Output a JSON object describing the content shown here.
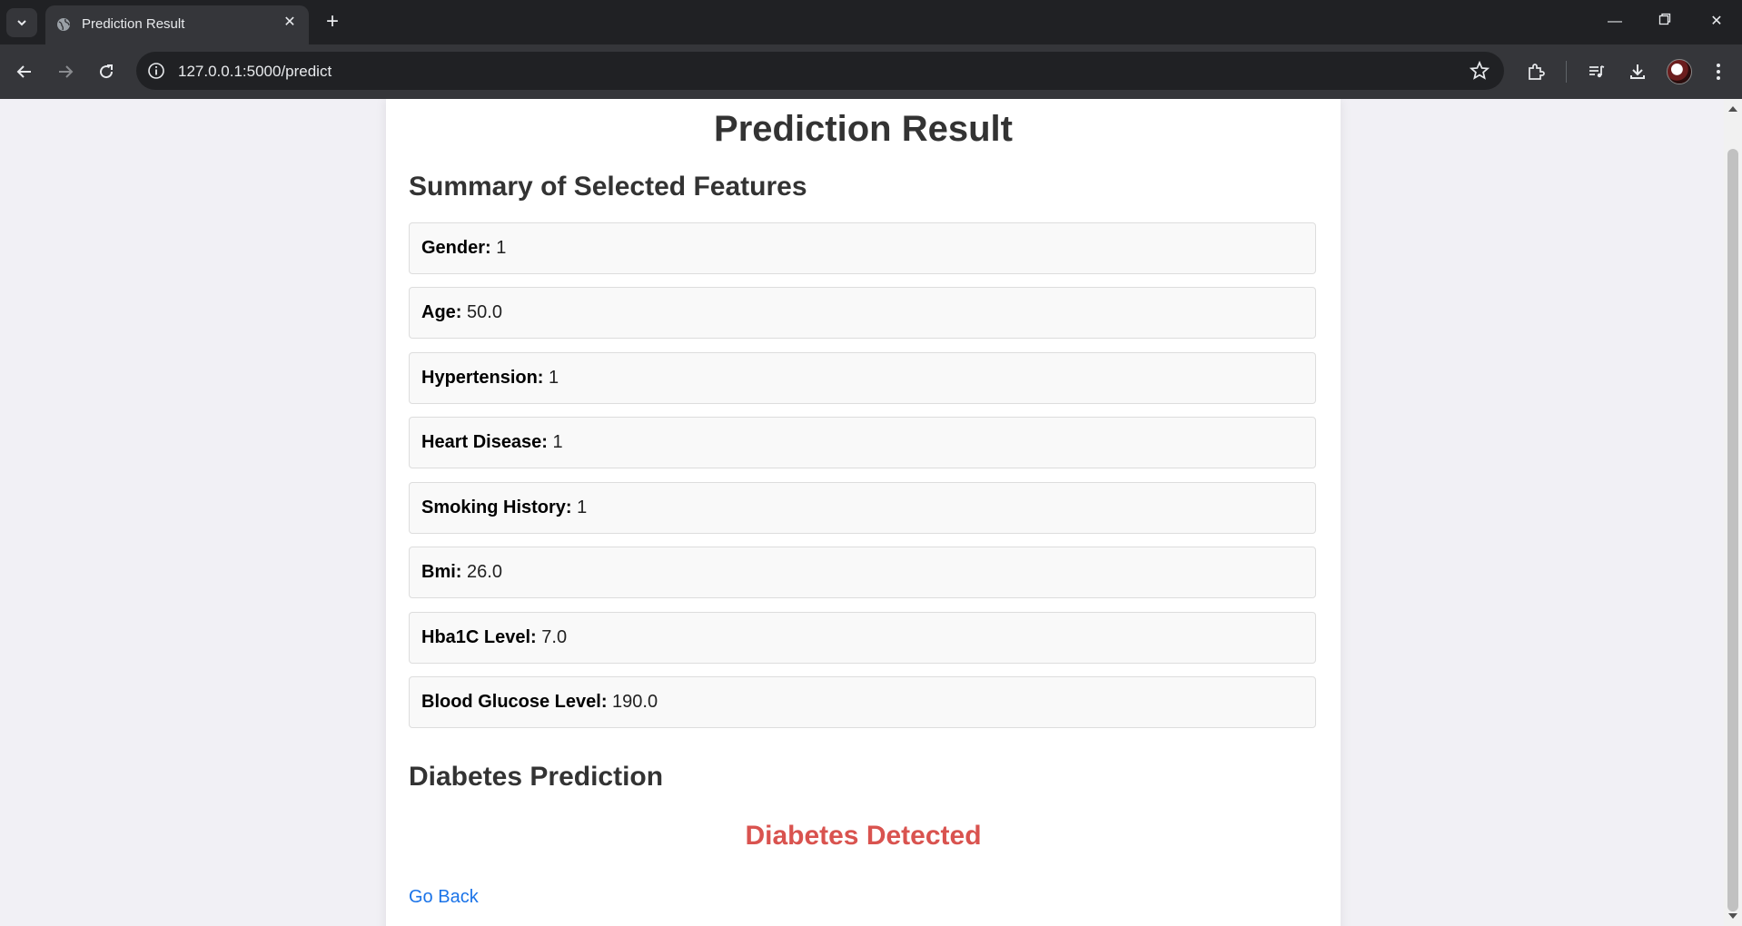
{
  "browser": {
    "tab_title": "Prediction Result",
    "url": "127.0.0.1:5000/predict"
  },
  "page": {
    "title": "Prediction Result",
    "summary_heading": "Summary of Selected Features",
    "features": [
      {
        "label": "Gender:",
        "value": "1"
      },
      {
        "label": "Age:",
        "value": "50.0"
      },
      {
        "label": "Hypertension:",
        "value": "1"
      },
      {
        "label": "Heart Disease:",
        "value": "1"
      },
      {
        "label": "Smoking History:",
        "value": "1"
      },
      {
        "label": "Bmi:",
        "value": "26.0"
      },
      {
        "label": "Hba1C Level:",
        "value": "7.0"
      },
      {
        "label": "Blood Glucose Level:",
        "value": "190.0"
      }
    ],
    "prediction_heading": "Diabetes Prediction",
    "prediction_result": "Diabetes Detected",
    "go_back_label": "Go Back"
  },
  "colors": {
    "result_red": "#d9534f",
    "link_blue": "#1a73e8",
    "heading_dark": "#333333"
  }
}
